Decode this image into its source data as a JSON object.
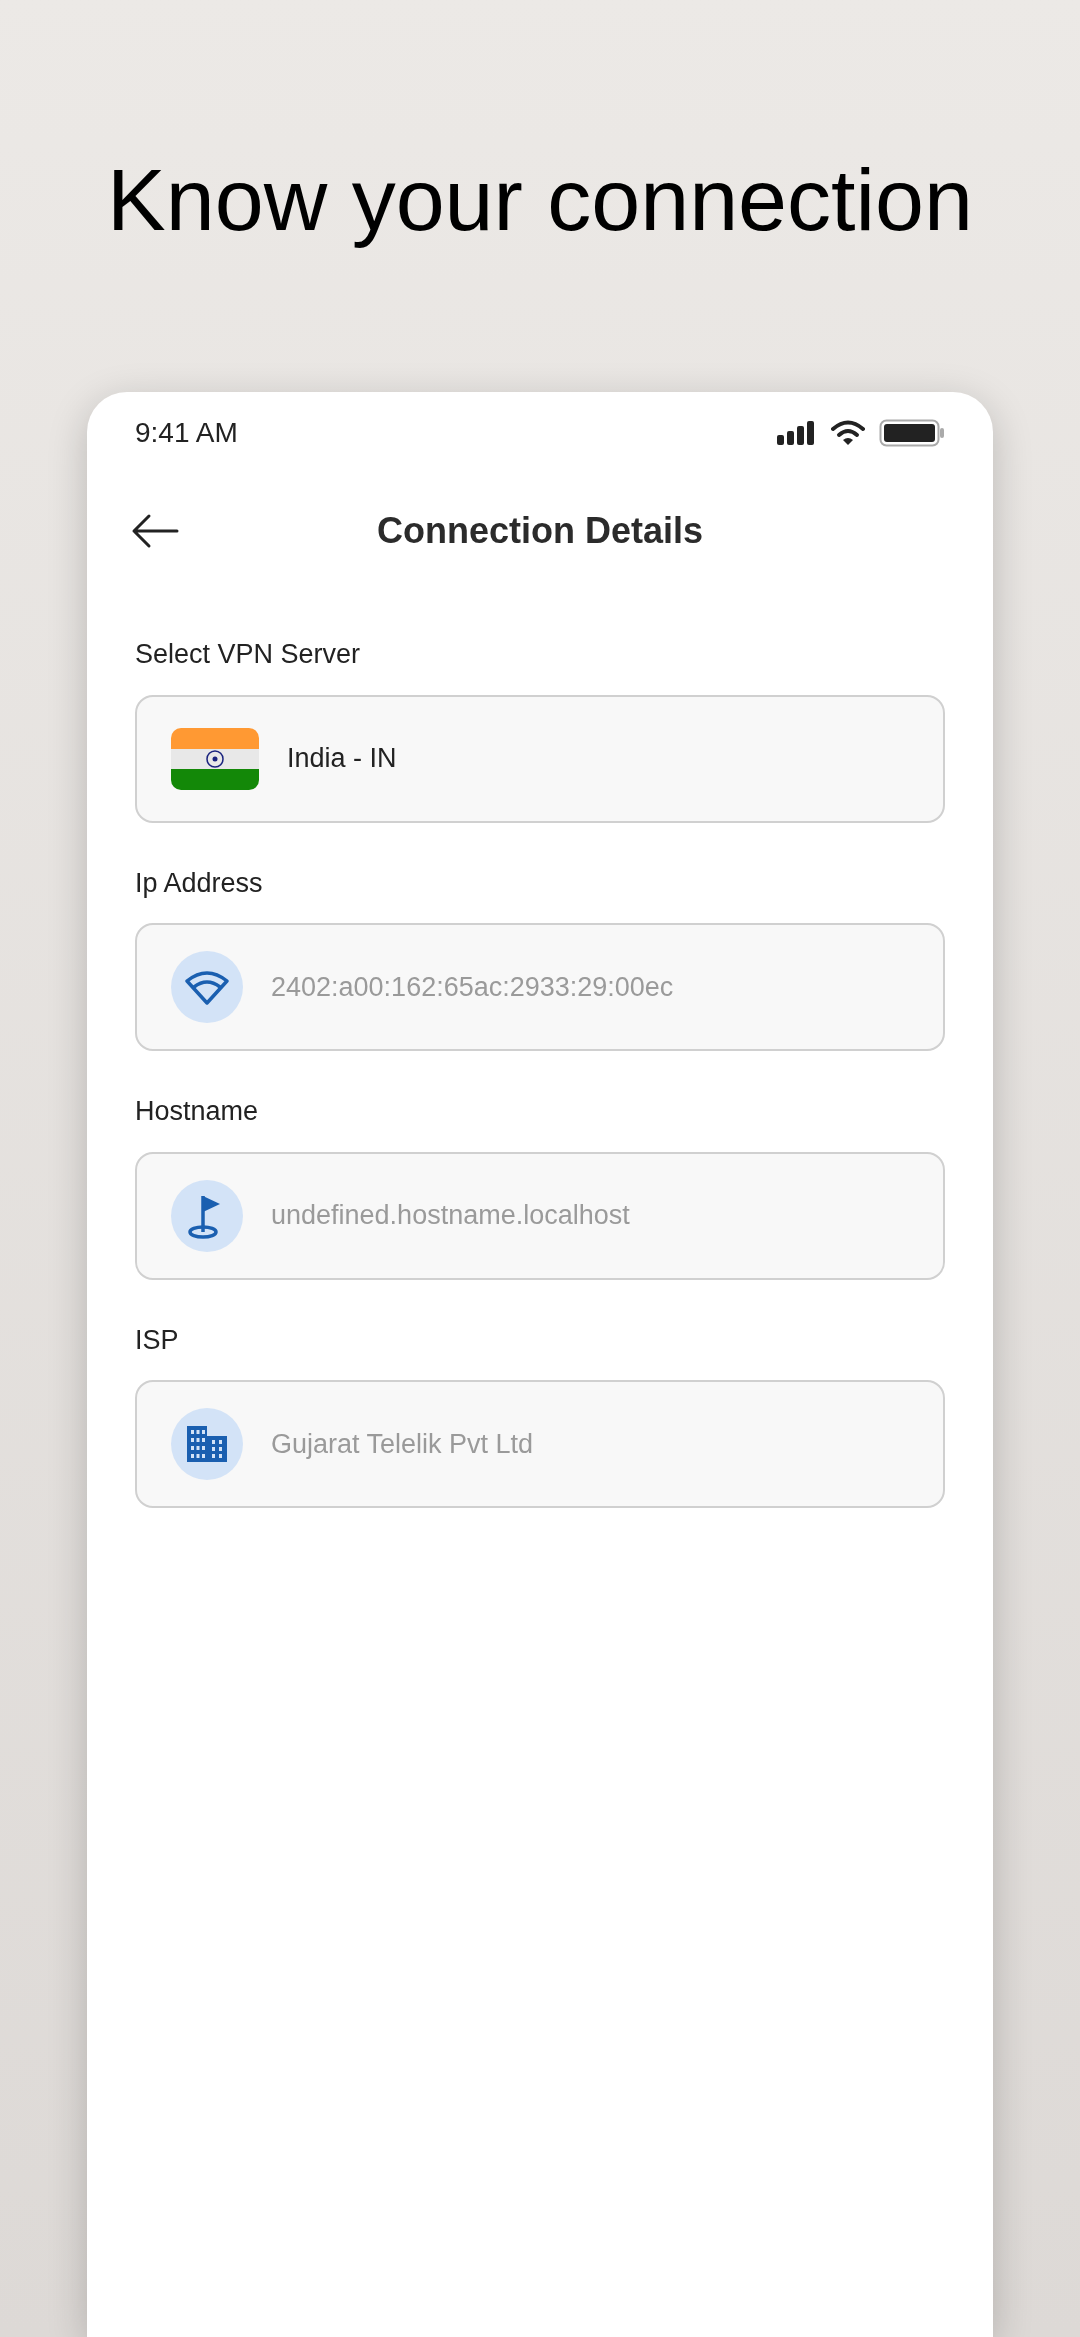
{
  "headline": "Know your connection",
  "status_bar": {
    "time": "9:41 AM"
  },
  "header": {
    "title": "Connection Details"
  },
  "fields": [
    {
      "label": "Select VPN Server",
      "kind": "flag",
      "value": "India - IN"
    },
    {
      "label": "Ip Address",
      "kind": "wifi",
      "value": "2402:a00:162:65ac:2933:29:00ec"
    },
    {
      "label": "Hostname",
      "kind": "pin",
      "value": "undefined.hostname.localhost"
    },
    {
      "label": "ISP",
      "kind": "building",
      "value": "Gujarat Telelik Pvt Ltd"
    }
  ]
}
